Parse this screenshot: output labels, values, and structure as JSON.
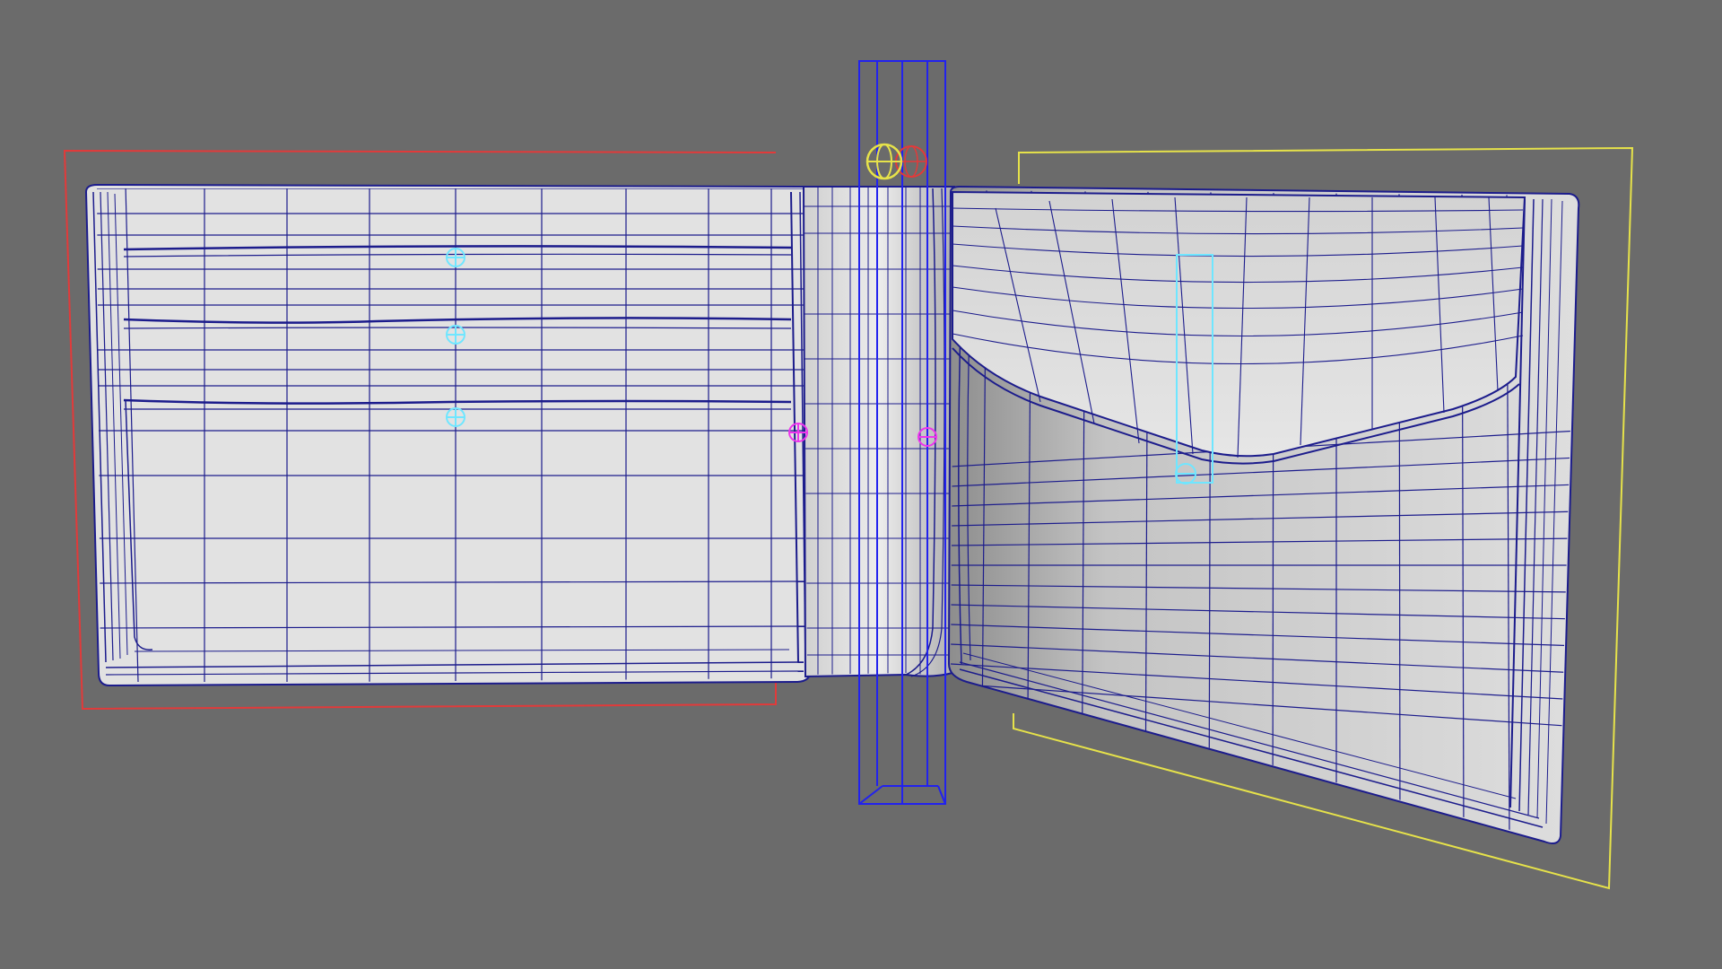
{
  "viewport": {
    "view": "3d-viewport",
    "background_color": "#6b6b6b"
  },
  "scene": {
    "object": "bifold-wallet-mesh",
    "display_mode": "wireframe-on-shaded",
    "mesh_surface_color": "#e4e4e4",
    "wire_color": "#1c1c8c"
  },
  "rig": {
    "left_panel_frame_color": "#e23a3a",
    "right_panel_frame_color": "#e6e24a",
    "hinge_bone_color": "#2222ee",
    "card_slot_locator_color": "#6fe6ff",
    "hinge_locator_color": "#ee33ee",
    "ik_handle_color": "#e6e24a",
    "ik_handle_secondary_color": "#e23a3a"
  },
  "icons": [
    "locator-icon",
    "ik-handle-icon"
  ]
}
